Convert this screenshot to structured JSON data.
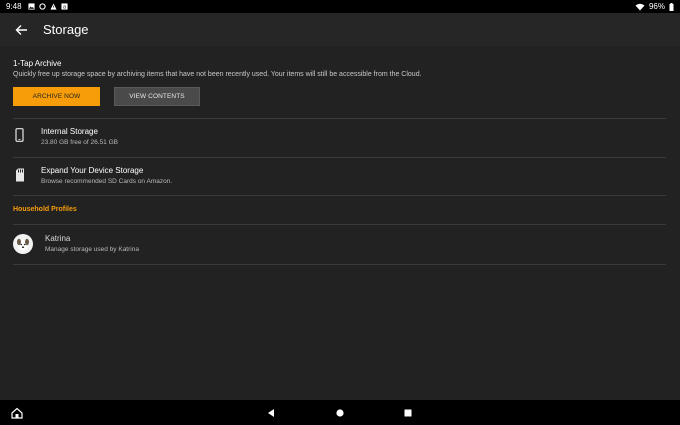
{
  "status_bar": {
    "time": "9:48",
    "battery": "96%"
  },
  "app_bar": {
    "title": "Storage",
    "back_icon": "arrow-left-icon"
  },
  "archive": {
    "heading": "1-Tap Archive",
    "description": "Quickly free up storage space by archiving items that have not been recently used. Your items will still be accessible from the Cloud.",
    "archive_button": "ARCHIVE NOW",
    "view_button": "VIEW CONTENTS"
  },
  "internal_storage": {
    "title": "Internal Storage",
    "detail": "23.80 GB free of 26.51 GB",
    "icon": "phone-icon"
  },
  "expand_storage": {
    "title": "Expand Your Device Storage",
    "detail": "Browse recommended SD Cards on Amazon.",
    "icon": "sd-card-icon"
  },
  "household": {
    "section_title": "Household Profiles",
    "profiles": [
      {
        "name": "Katrina",
        "detail": "Manage storage used by Katrina"
      }
    ]
  },
  "nav_bar": {
    "home_icon": "home-icon",
    "back_icon": "triangle-back-icon",
    "circle_icon": "circle-home-icon",
    "recents_icon": "square-recents-icon"
  },
  "colors": {
    "accent": "#f79d0a",
    "background": "#222222",
    "app_bar": "#262626",
    "secondary_button": "#4a4a4a"
  }
}
